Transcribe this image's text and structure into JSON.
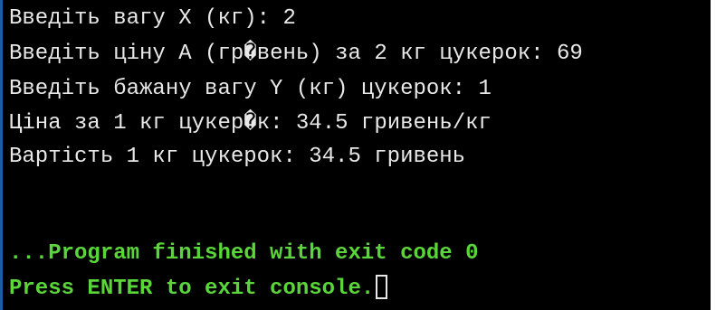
{
  "console": {
    "output_lines": [
      "Введіть вагу X (кг): 2",
      "Введіть ціну A (гр�вень) за 2 кг цукерок: 69",
      "Введіть бажану вагу Y (кг) цукерок: 1",
      "Ціна за 1 кг цукер�к: 34.5 гривень/кг",
      "Вартість 1 кг цукерок: 34.5 гривень"
    ],
    "exit_message": "...Program finished with exit code 0",
    "prompt_message": "Press ENTER to exit console."
  },
  "colors": {
    "background": "#000000",
    "text": "#e8e8e8",
    "status_text": "#5ad63a"
  }
}
